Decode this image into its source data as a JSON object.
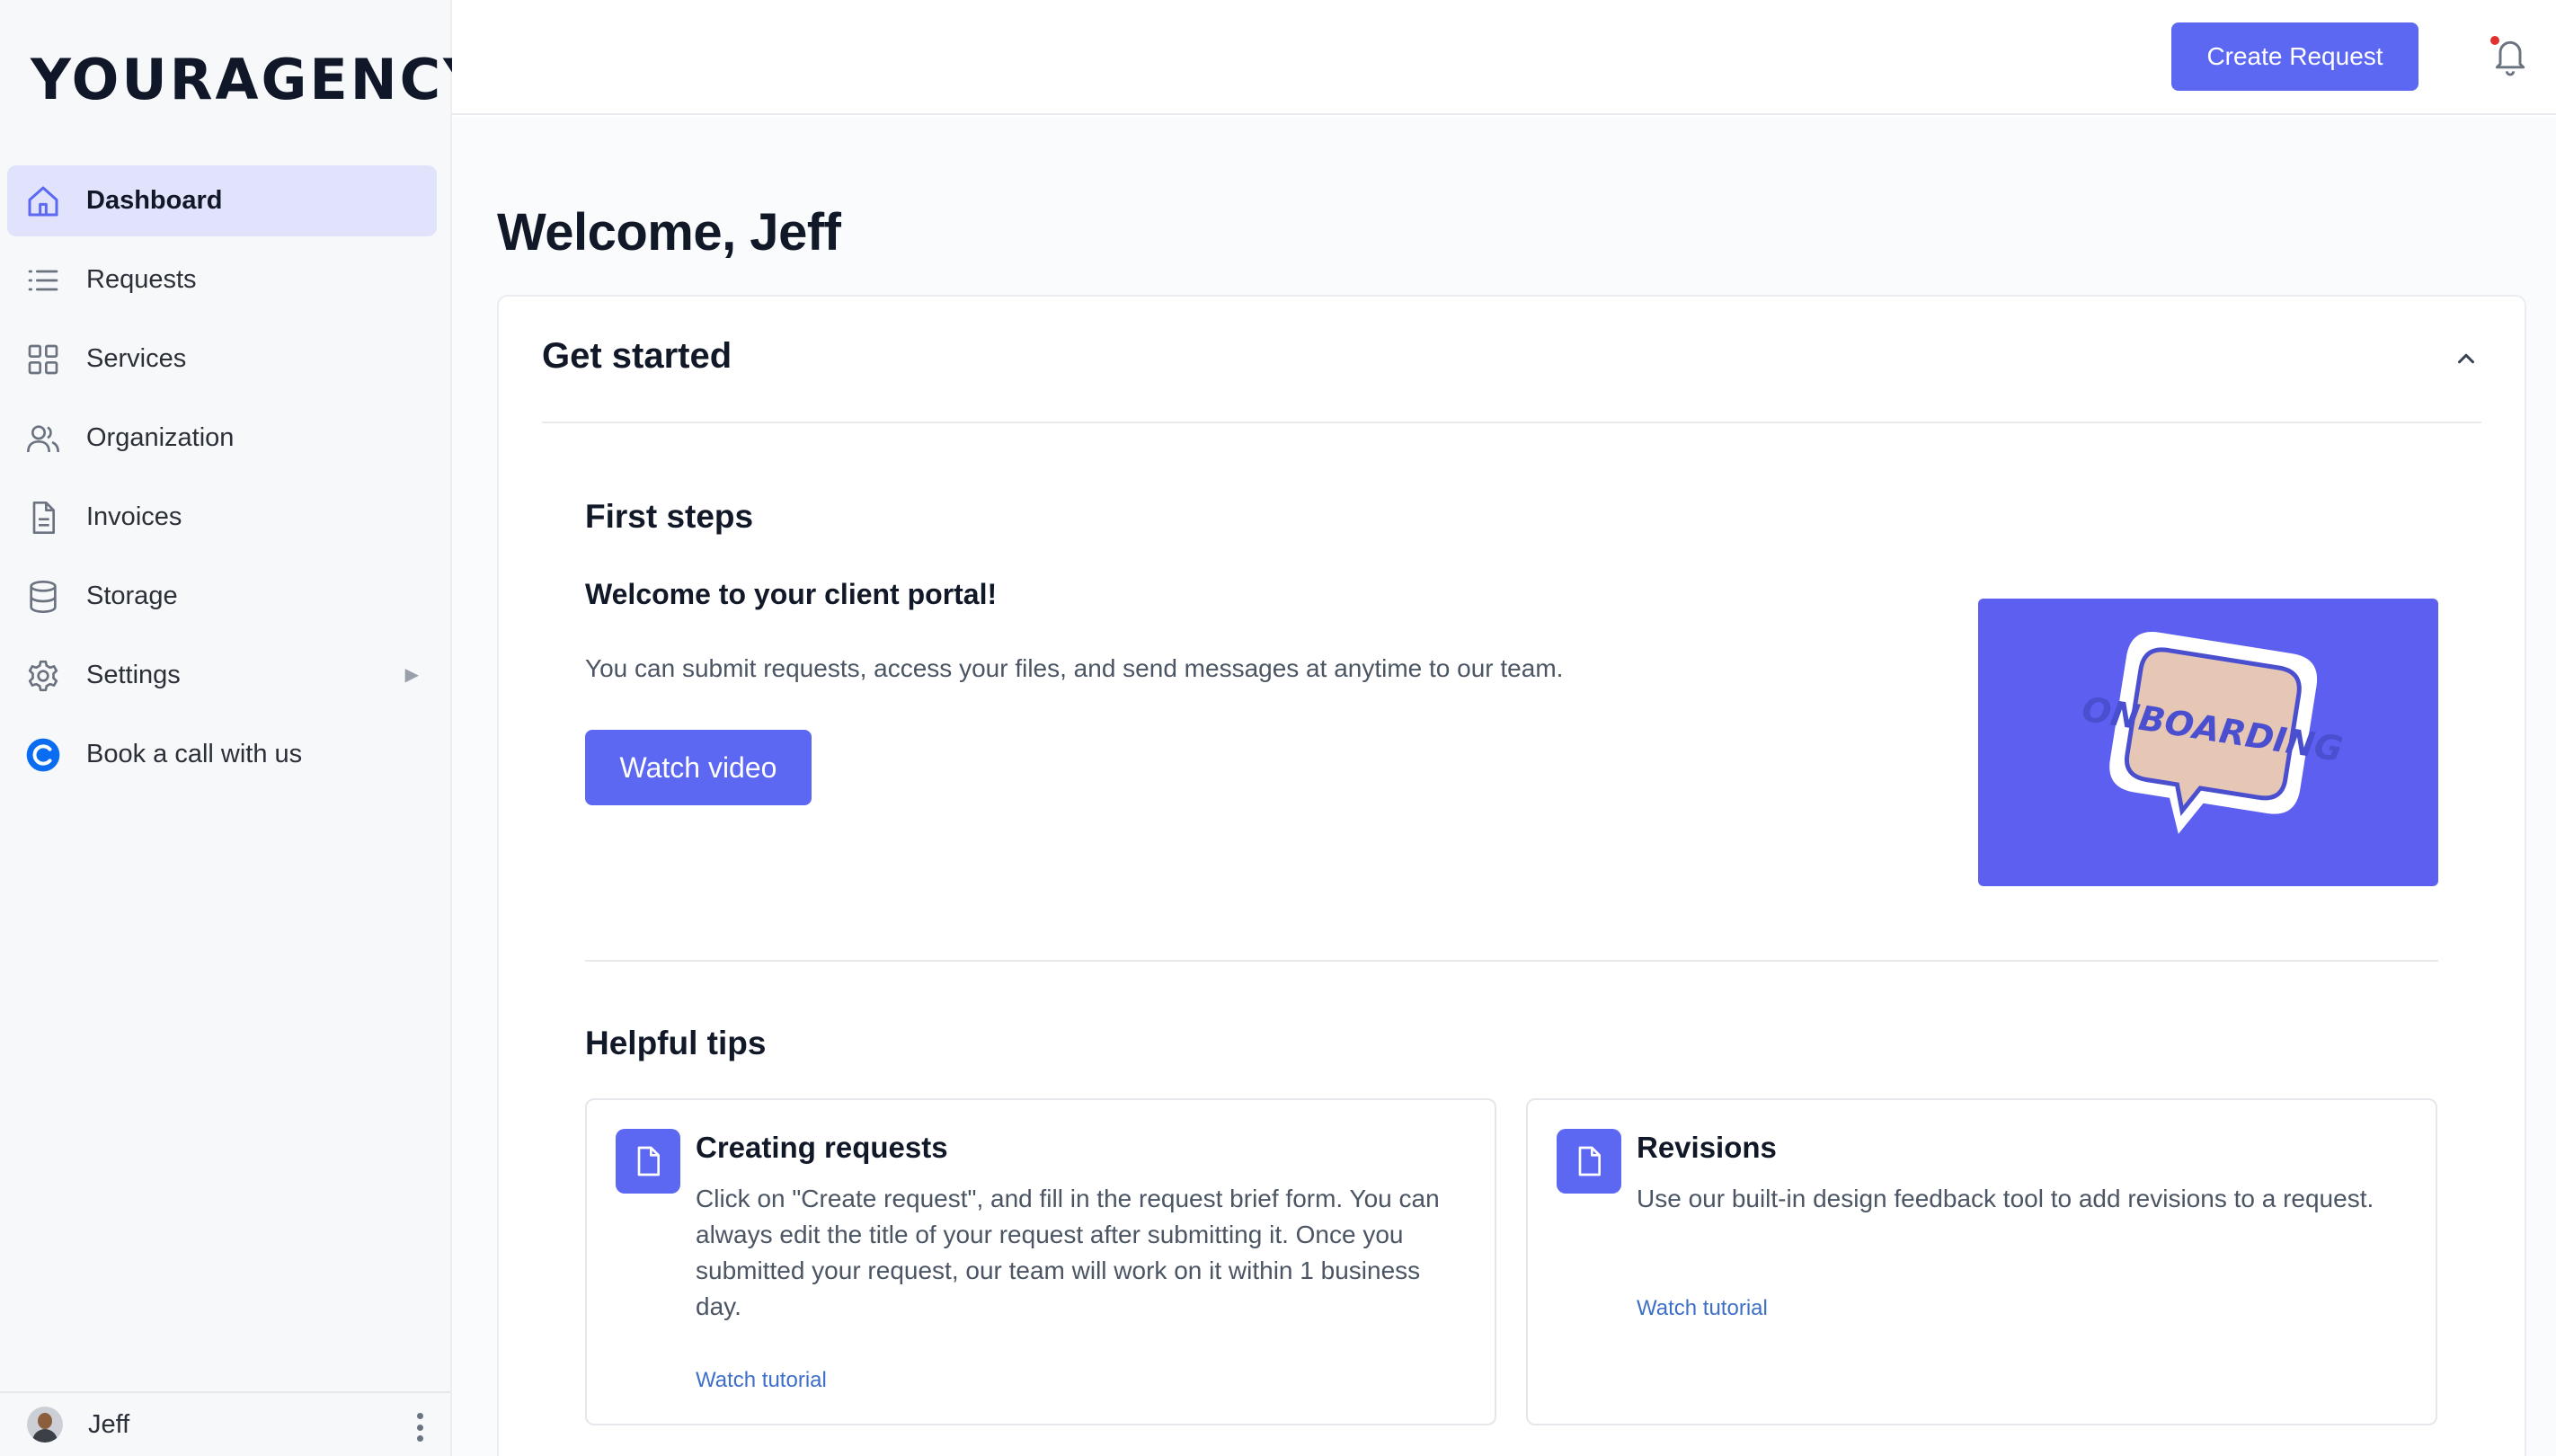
{
  "sidebar": {
    "logo": "YOURAGENCY",
    "items": [
      {
        "label": "Dashboard",
        "icon": "home-icon",
        "active": true
      },
      {
        "label": "Requests",
        "icon": "list-icon"
      },
      {
        "label": "Services",
        "icon": "grid-icon"
      },
      {
        "label": "Organization",
        "icon": "users-icon"
      },
      {
        "label": "Invoices",
        "icon": "document-icon"
      },
      {
        "label": "Storage",
        "icon": "database-icon"
      },
      {
        "label": "Settings",
        "icon": "gear-icon",
        "expandable": true
      },
      {
        "label": "Book a call with us",
        "icon": "calendly-icon"
      }
    ],
    "user": {
      "name": "Jeff"
    }
  },
  "topbar": {
    "create_label": "Create Request",
    "notification_icon": "bell-icon",
    "accent": "#5c67f2"
  },
  "main": {
    "welcome": "Welcome, Jeff",
    "card": {
      "title": "Get started",
      "first_steps": {
        "title": "First steps",
        "subtitle": "Welcome to your client portal!",
        "description": "You can submit requests, access your files, and send messages at anytime to our team.",
        "button": "Watch video",
        "thumbnail_text": "ONBOARDING"
      },
      "tips": {
        "title": "Helpful tips",
        "items": [
          {
            "title": "Creating requests",
            "text": "Click on \"Create request\", and fill in the request brief form. You can always edit the title of your request after submitting it. Once you submitted your request, our team will work on it within 1 business day.",
            "link": "Watch tutorial"
          },
          {
            "title": "Revisions",
            "text": "Use our built-in design feedback tool to add revisions to a request.",
            "link": "Watch tutorial"
          }
        ]
      }
    }
  }
}
